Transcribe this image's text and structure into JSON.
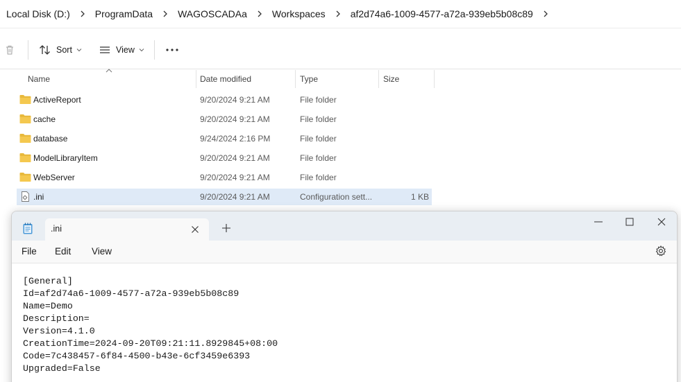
{
  "breadcrumb": [
    "Local Disk (D:)",
    "ProgramData",
    "WAGOSCADAa",
    "Workspaces",
    "af2d74a6-1009-4577-a72a-939eb5b08c89"
  ],
  "toolbar": {
    "sort_label": "Sort",
    "view_label": "View",
    "more_label": "..."
  },
  "columns": {
    "name": "Name",
    "date": "Date modified",
    "type": "Type",
    "size": "Size"
  },
  "files": [
    {
      "name": "ActiveReport",
      "date": "9/20/2024 9:21 AM",
      "type": "File folder",
      "size": "",
      "kind": "folder"
    },
    {
      "name": "cache",
      "date": "9/20/2024 9:21 AM",
      "type": "File folder",
      "size": "",
      "kind": "folder"
    },
    {
      "name": "database",
      "date": "9/24/2024 2:16 PM",
      "type": "File folder",
      "size": "",
      "kind": "folder"
    },
    {
      "name": "ModelLibraryItem",
      "date": "9/20/2024 9:21 AM",
      "type": "File folder",
      "size": "",
      "kind": "folder"
    },
    {
      "name": "WebServer",
      "date": "9/20/2024 9:21 AM",
      "type": "File folder",
      "size": "",
      "kind": "folder"
    },
    {
      "name": ".ini",
      "date": "9/20/2024 9:21 AM",
      "type": "Configuration sett...",
      "size": "1 KB",
      "kind": "ini"
    }
  ],
  "notepad": {
    "tab_title": ".ini",
    "menu": [
      "File",
      "Edit",
      "View"
    ],
    "lines": [
      "[General]",
      "Id=af2d74a6-1009-4577-a72a-939eb5b08c89",
      "Name=Demo",
      "Description=",
      "Version=4.1.0",
      "CreationTime=2024-09-20T09:21:11.8929845+08:00",
      "Code=7c438457-6f84-4500-b43e-6cf3459e6393",
      "Upgraded=False"
    ]
  },
  "colors": {
    "selection": "#dfeaf7",
    "folder": "#f0c24b",
    "titlebar": "#e9eef3"
  }
}
